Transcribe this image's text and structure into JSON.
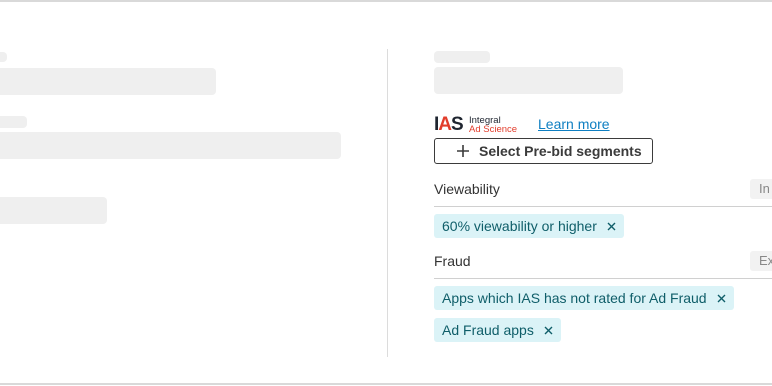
{
  "ias": {
    "logo_mark": "IAS",
    "logo_line1": "Integral",
    "logo_line2": "Ad Science",
    "learn_more": "Learn more"
  },
  "select_button": {
    "label": "Select Pre-bid segments",
    "icon": "plus-icon"
  },
  "sections": {
    "viewability": {
      "label": "Viewability",
      "badge": "In",
      "chips": [
        "60% viewability or higher"
      ]
    },
    "fraud": {
      "label": "Fraud",
      "badge": "Ex",
      "chips": [
        "Apps which IAS has not rated for Ad Fraud",
        "Ad Fraud apps"
      ]
    }
  },
  "colors": {
    "chip_bg": "#dbf3f7",
    "chip_text": "#0f5e69",
    "link": "#0f7fc2",
    "ias_red": "#e23d2c",
    "skeleton": "#efefef"
  }
}
